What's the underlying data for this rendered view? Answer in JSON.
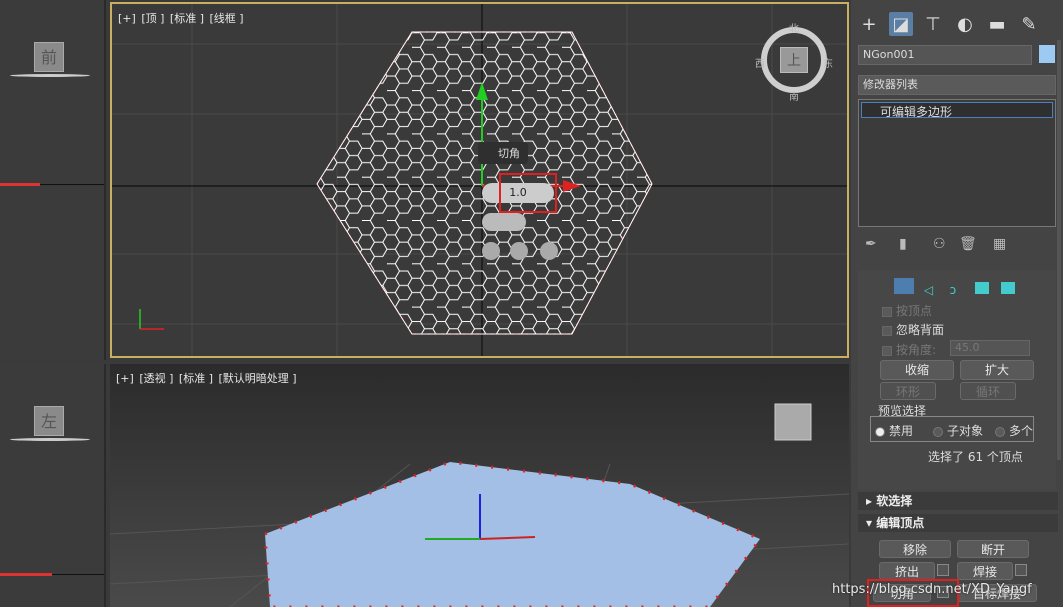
{
  "viewports": {
    "top": {
      "labels": [
        "[+]",
        "[顶 ]",
        "[标准 ]",
        "[线框 ]"
      ]
    },
    "persp": {
      "labels": [
        "[+]",
        "[透视 ]",
        "[标准 ]",
        "[默认明暗处理 ]"
      ]
    },
    "front_side": {
      "label": "前"
    },
    "left_side": {
      "label": "左"
    },
    "viewcube_top": {
      "north": "北",
      "south": "南",
      "east": "东",
      "west": "西",
      "face": "上"
    }
  },
  "caddy": {
    "title": "切角",
    "value": "1.0"
  },
  "panel": {
    "object_name": "NGon001",
    "modifier_list": "修改器列表",
    "stack_item": "可编辑多边形",
    "selection": {
      "by_vertex": "按顶点",
      "ignore_backfacing": "忽略背面",
      "by_angle": "按角度:",
      "angle_value": "45.0",
      "shrink": "收缩",
      "grow": "扩大",
      "ring": "环形",
      "loop": "循环",
      "preview_title": "预览选择",
      "preview_off": "禁用",
      "preview_subobj": "子对象",
      "preview_multi": "多个",
      "status": "选择了 61 个顶点"
    },
    "soft_selection": "软选择",
    "edit_vertices": {
      "title": "编辑顶点",
      "remove": "移除",
      "break": "断开",
      "extrude": "挤出",
      "weld": "焊接",
      "chamfer": "切角",
      "target_weld": "目标焊接"
    }
  },
  "watermark": "https://blog.csdn.net/XD_Yangf",
  "colors": {
    "accent": "#e02020",
    "viewport_border": "#c8b060",
    "mesh_fill": "#a4bfe6"
  }
}
